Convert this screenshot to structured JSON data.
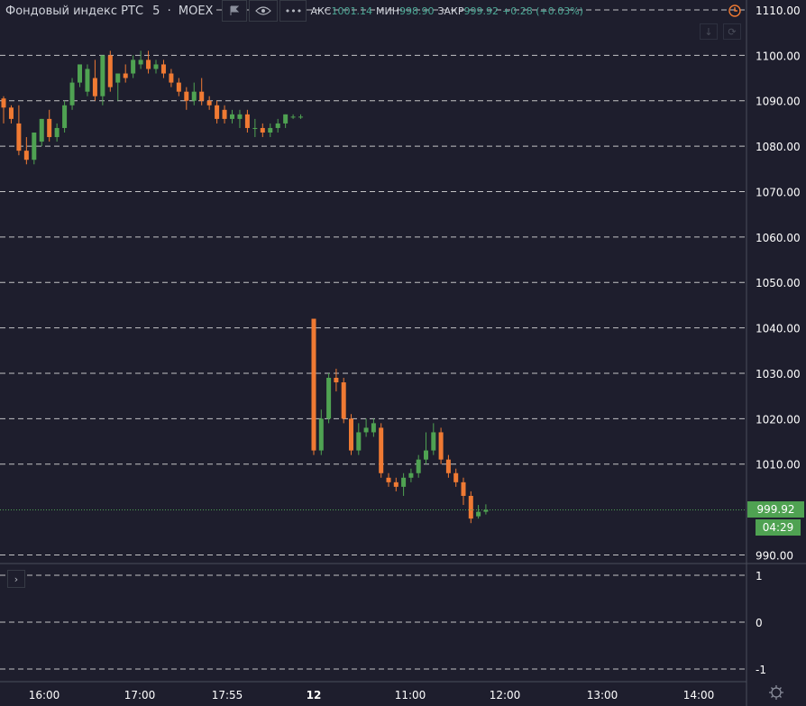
{
  "legend": {
    "symbol": "Фондовый индекс РТС",
    "interval": "5",
    "exchange": "MOEX",
    "high_label": "АКС",
    "high_value": "1001.14",
    "low_label": "МИН",
    "low_value": "998.90",
    "close_label": "ЗАКР",
    "close_value": "999.92",
    "change": "+0.28 (+0.03%)"
  },
  "price_axis": {
    "ticks": [
      "1110.00",
      "1100.00",
      "1090.00",
      "1080.00",
      "1070.00",
      "1060.00",
      "1050.00",
      "1040.00",
      "1030.00",
      "1020.00",
      "1010.00",
      "990.00"
    ]
  },
  "indicator_axis": {
    "ticks": [
      "1",
      "0",
      "-1"
    ]
  },
  "last_price": {
    "value": "999.92",
    "countdown": "04:29"
  },
  "time_axis": {
    "labels": [
      "16:00",
      "17:00",
      "17:55",
      "12",
      "11:00",
      "12:00",
      "13:00",
      "14:00"
    ]
  },
  "colors": {
    "up": "#4fa252",
    "down": "#f07a33",
    "background": "#1e1e2d",
    "grid": "#e0e0e0",
    "last_price": "#4fa252"
  },
  "chart_data": {
    "type": "candlestick",
    "title": "Фондовый индекс РТС",
    "interval": "5",
    "ylim": [
      989,
      1112
    ],
    "session1": [
      {
        "o": 1090.5,
        "h": 1091,
        "c": 1088.5,
        "l": 1085
      },
      {
        "o": 1088.5,
        "h": 1089,
        "c": 1086,
        "l": 1085
      },
      {
        "o": 1085,
        "h": 1089,
        "c": 1079,
        "l": 1078
      },
      {
        "o": 1079,
        "h": 1082,
        "c": 1077,
        "l": 1076
      },
      {
        "o": 1077,
        "h": 1083,
        "c": 1083,
        "l": 1076
      },
      {
        "o": 1081,
        "h": 1086,
        "c": 1086,
        "l": 1080
      },
      {
        "o": 1086,
        "h": 1088,
        "c": 1082,
        "l": 1081
      },
      {
        "o": 1082,
        "h": 1085,
        "c": 1084,
        "l": 1081
      },
      {
        "o": 1084,
        "h": 1090,
        "c": 1089,
        "l": 1083
      },
      {
        "o": 1089,
        "h": 1095,
        "c": 1094,
        "l": 1088
      },
      {
        "o": 1094,
        "h": 1096,
        "c": 1098,
        "l": 1093
      },
      {
        "o": 1092,
        "h": 1098,
        "c": 1097,
        "l": 1091
      },
      {
        "o": 1095,
        "h": 1099,
        "c": 1091,
        "l": 1090
      },
      {
        "o": 1091,
        "h": 1099,
        "c": 1100,
        "l": 1089
      },
      {
        "o": 1100,
        "h": 1101,
        "c": 1093,
        "l": 1092
      },
      {
        "o": 1094,
        "h": 1096,
        "c": 1096,
        "l": 1090
      },
      {
        "o": 1096,
        "h": 1098,
        "c": 1095,
        "l": 1094
      },
      {
        "o": 1096,
        "h": 1100,
        "c": 1099,
        "l": 1095
      },
      {
        "o": 1098,
        "h": 1101,
        "c": 1099,
        "l": 1097
      },
      {
        "o": 1099,
        "h": 1101,
        "c": 1097,
        "l": 1096
      },
      {
        "o": 1097,
        "h": 1099,
        "c": 1098,
        "l": 1096
      },
      {
        "o": 1098,
        "h": 1099,
        "c": 1096,
        "l": 1095
      },
      {
        "o": 1096,
        "h": 1097,
        "c": 1094,
        "l": 1093
      },
      {
        "o": 1094,
        "h": 1095,
        "c": 1092,
        "l": 1091
      },
      {
        "o": 1092,
        "h": 1093,
        "c": 1090,
        "l": 1088
      },
      {
        "o": 1090,
        "h": 1094,
        "c": 1092,
        "l": 1089
      },
      {
        "o": 1092,
        "h": 1095,
        "c": 1090,
        "l": 1089
      },
      {
        "o": 1090,
        "h": 1091,
        "c": 1089,
        "l": 1088
      },
      {
        "o": 1089,
        "h": 1090,
        "c": 1086,
        "l": 1085
      },
      {
        "o": 1088,
        "h": 1089,
        "c": 1086,
        "l": 1085
      },
      {
        "o": 1086,
        "h": 1088,
        "c": 1087,
        "l": 1085
      },
      {
        "o": 1086,
        "h": 1088,
        "c": 1087,
        "l": 1084
      },
      {
        "o": 1087,
        "h": 1088,
        "c": 1084,
        "l": 1083
      },
      {
        "o": 1084,
        "h": 1086,
        "c": 1084,
        "l": 1082
      },
      {
        "o": 1084,
        "h": 1085,
        "c": 1083,
        "l": 1082
      },
      {
        "o": 1083,
        "h": 1085,
        "c": 1084,
        "l": 1082
      },
      {
        "o": 1084,
        "h": 1086,
        "c": 1085,
        "l": 1083
      },
      {
        "o": 1085,
        "h": 1087,
        "c": 1087,
        "l": 1084
      },
      {
        "o": 1086.5,
        "h": 1087,
        "c": 1086.5,
        "l": 1086
      },
      {
        "o": 1086.5,
        "h": 1087,
        "c": 1086.5,
        "l": 1086
      }
    ],
    "session2": [
      {
        "o": 1042,
        "h": 1042,
        "c": 1013,
        "l": 1012
      },
      {
        "o": 1013,
        "h": 1022,
        "c": 1020,
        "l": 1012
      },
      {
        "o": 1020,
        "h": 1030,
        "c": 1029,
        "l": 1019
      },
      {
        "o": 1029,
        "h": 1031,
        "c": 1028,
        "l": 1026
      },
      {
        "o": 1028,
        "h": 1029,
        "c": 1020,
        "l": 1019
      },
      {
        "o": 1020,
        "h": 1021,
        "c": 1013,
        "l": 1012
      },
      {
        "o": 1013,
        "h": 1019,
        "c": 1017,
        "l": 1012
      },
      {
        "o": 1017,
        "h": 1020,
        "c": 1018,
        "l": 1016
      },
      {
        "o": 1017,
        "h": 1020,
        "c": 1019,
        "l": 1016
      },
      {
        "o": 1018,
        "h": 1019,
        "c": 1008,
        "l": 1007
      },
      {
        "o": 1007,
        "h": 1008,
        "c": 1006,
        "l": 1005
      },
      {
        "o": 1006,
        "h": 1007,
        "c": 1005,
        "l": 1004
      },
      {
        "o": 1005,
        "h": 1008,
        "c": 1007,
        "l": 1003
      },
      {
        "o": 1007,
        "h": 1009,
        "c": 1008,
        "l": 1006
      },
      {
        "o": 1008,
        "h": 1012,
        "c": 1011,
        "l": 1007
      },
      {
        "o": 1011,
        "h": 1017,
        "c": 1013,
        "l": 1010
      },
      {
        "o": 1013,
        "h": 1019,
        "c": 1017,
        "l": 1012
      },
      {
        "o": 1017,
        "h": 1018,
        "c": 1011,
        "l": 1010
      },
      {
        "o": 1011,
        "h": 1012,
        "c": 1008,
        "l": 1007
      },
      {
        "o": 1008,
        "h": 1009,
        "c": 1006,
        "l": 1005
      },
      {
        "o": 1006,
        "h": 1007,
        "c": 1003,
        "l": 1001
      },
      {
        "o": 1003,
        "h": 1004,
        "c": 998,
        "l": 997
      },
      {
        "o": 998.5,
        "h": 1001,
        "c": 999.5,
        "l": 998
      },
      {
        "o": 999.5,
        "h": 1001.14,
        "c": 999.92,
        "l": 998.9
      }
    ]
  }
}
